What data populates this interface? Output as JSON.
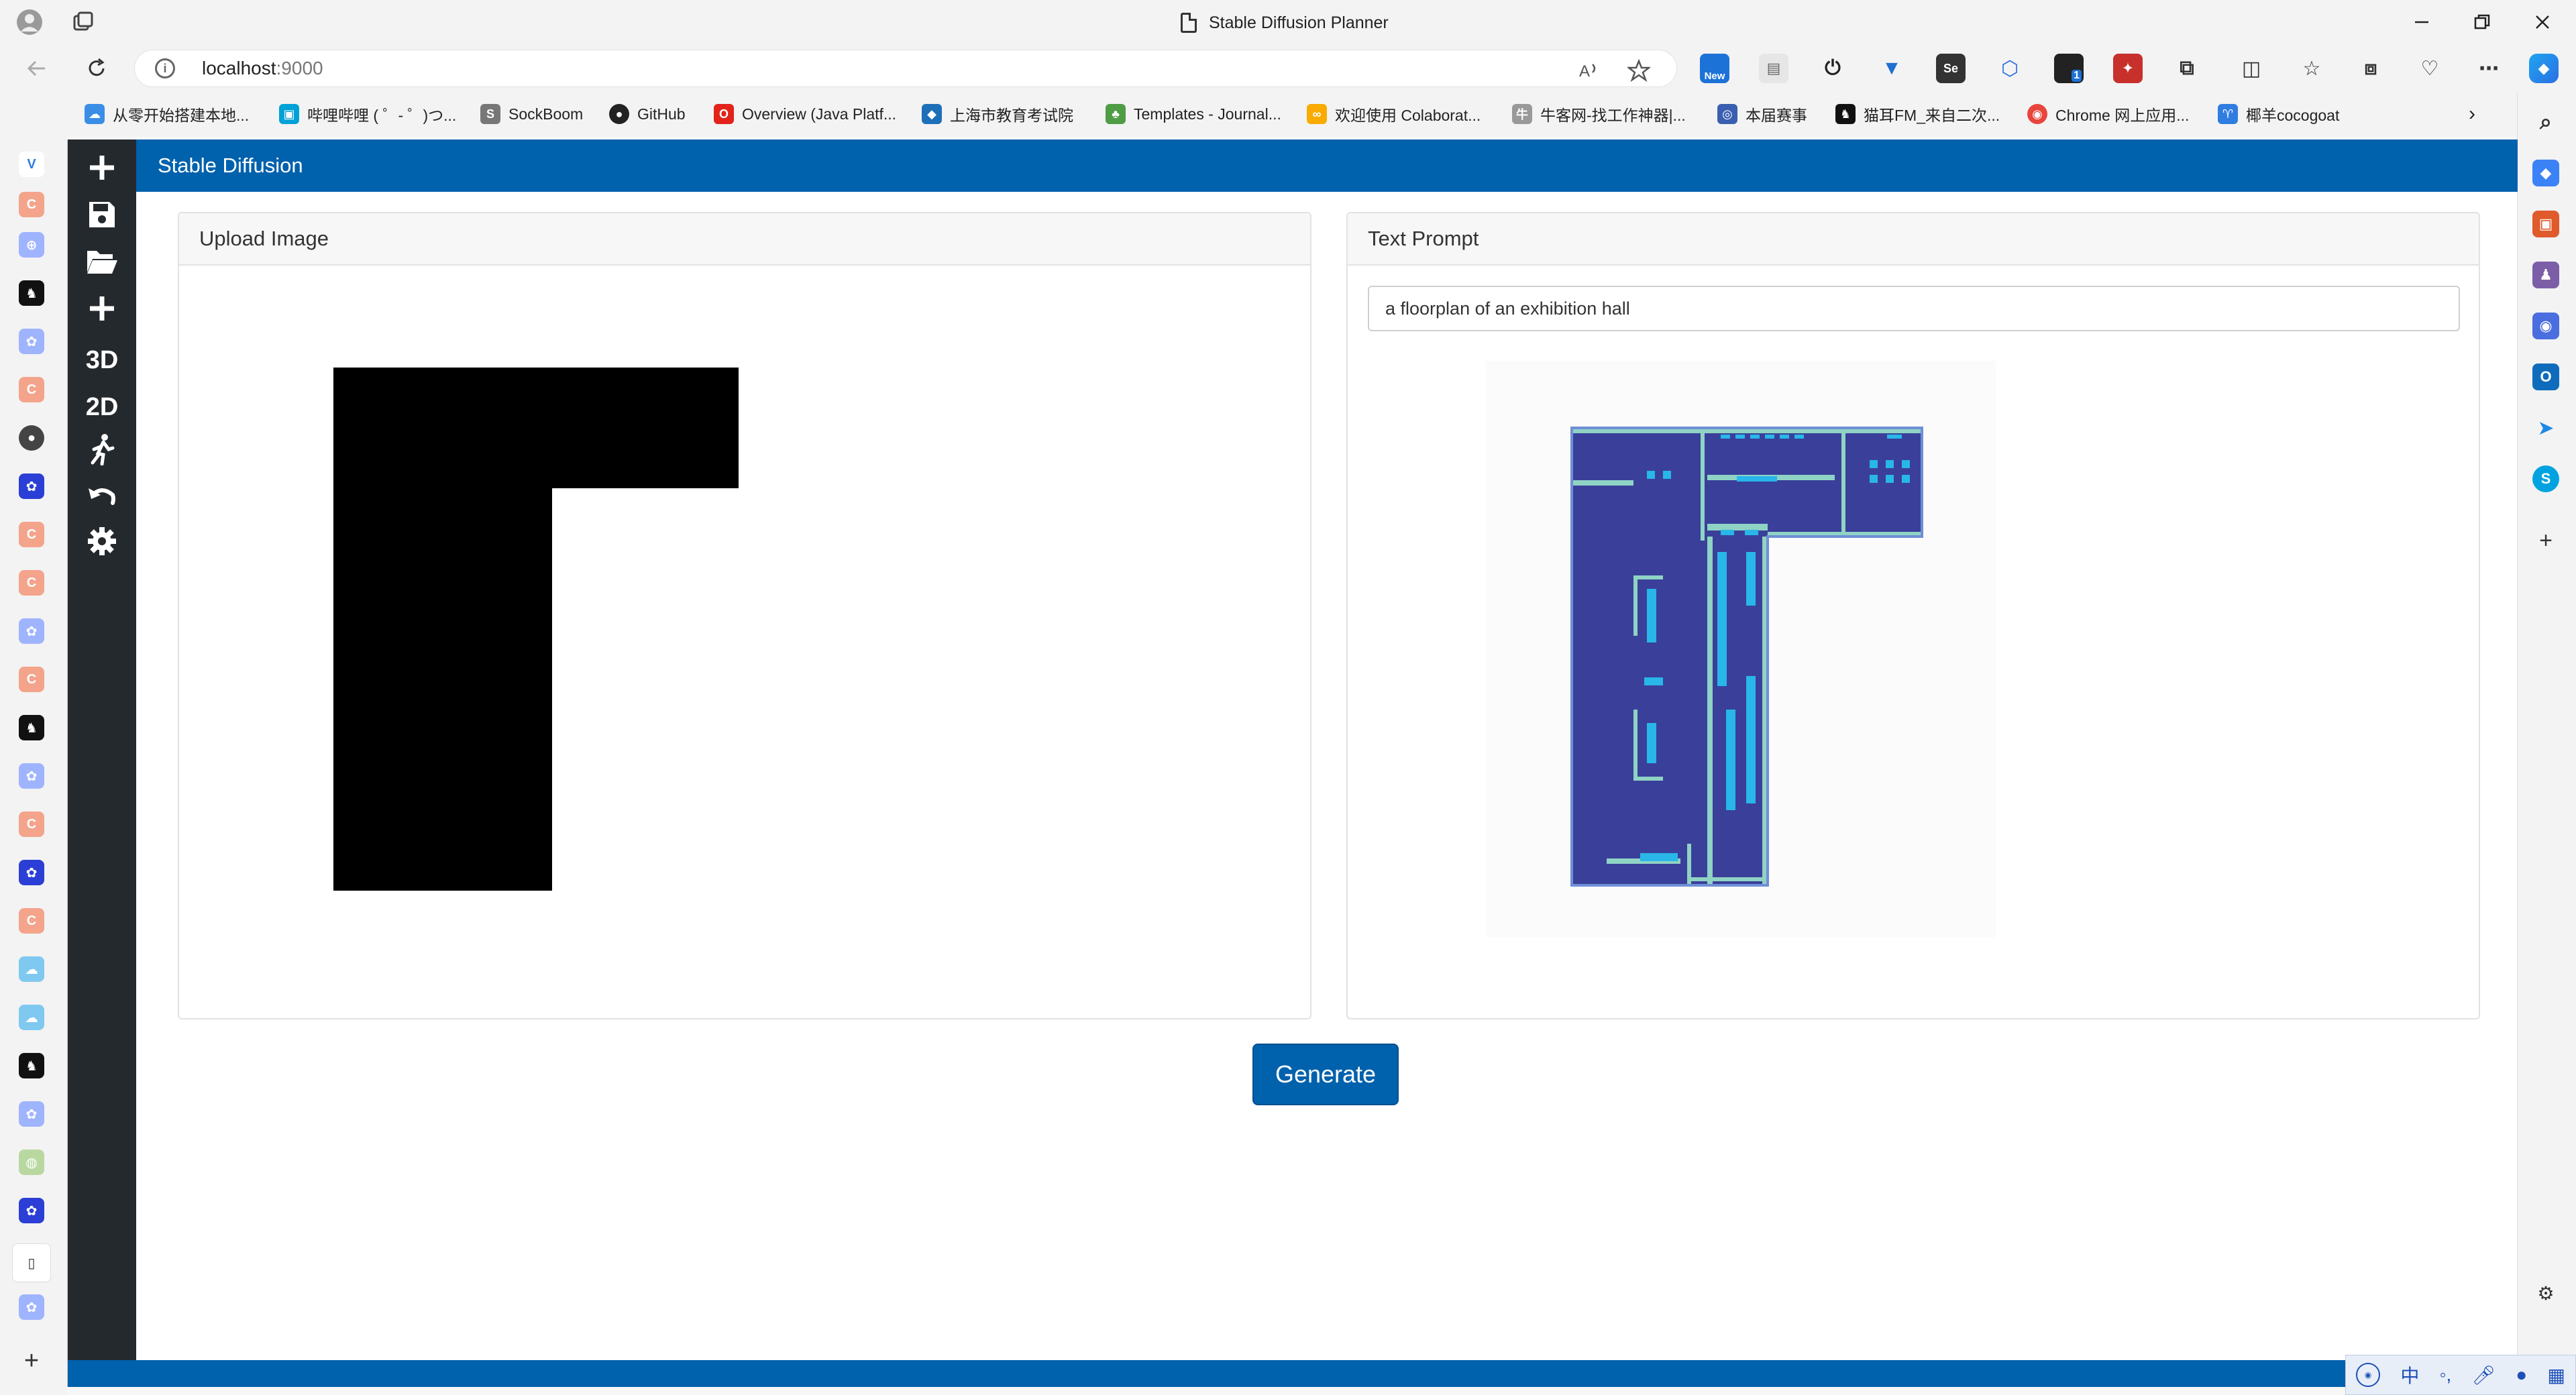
{
  "browser": {
    "window_title": "Stable Diffusion Planner",
    "url_host": "localhost",
    "url_port": ":9000",
    "extension_badge_new": "New",
    "extension_badge_count": "1",
    "extension_se": "Se"
  },
  "bookmarks": [
    {
      "label": "从零开始搭建本地...",
      "icon": "cloud-icon",
      "color": "#3a8ee6"
    },
    {
      "label": "哔哩哔哩 ( ゜- ゜)つ...",
      "icon": "bilibili-icon",
      "color": "#00a1d6"
    },
    {
      "label": "SockBoom",
      "icon": "sockboom-icon",
      "color": "#777777"
    },
    {
      "label": "GitHub",
      "icon": "github-icon",
      "color": "#222222"
    },
    {
      "label": "Overview (Java Platf...",
      "icon": "oracle-icon",
      "color": "#e2231a"
    },
    {
      "label": "上海市教育考试院",
      "icon": "school-icon",
      "color": "#1d6fb8"
    },
    {
      "label": "Templates - Journal...",
      "icon": "overleaf-icon",
      "color": "#4f9c45"
    },
    {
      "label": "欢迎使用 Colaborat...",
      "icon": "colab-icon",
      "color": "#f9ab00"
    },
    {
      "label": "牛客网-找工作神器|...",
      "icon": "nowcoder-icon",
      "color": "#999999"
    },
    {
      "label": "本届赛事",
      "icon": "contest-icon",
      "color": "#3a5fb0"
    },
    {
      "label": "猫耳FM_来自二次...",
      "icon": "missevan-icon",
      "color": "#111111"
    },
    {
      "label": "Chrome 网上应用...",
      "icon": "chrome-store-icon",
      "color": "#e8453c"
    },
    {
      "label": "椰羊cocogoat",
      "icon": "cocogoat-icon",
      "color": "#2f7de1"
    }
  ],
  "app": {
    "header_title": "Stable Diffusion",
    "toolbar": [
      {
        "name": "add-tool",
        "glyph": "+"
      },
      {
        "name": "save-tool",
        "glyph": "save"
      },
      {
        "name": "open-folder-tool",
        "glyph": "folder"
      },
      {
        "name": "add-object-tool",
        "glyph": "+"
      },
      {
        "name": "view-3d-tool",
        "glyph": "3D"
      },
      {
        "name": "view-2d-tool",
        "glyph": "2D"
      },
      {
        "name": "walk-tool",
        "glyph": "walk"
      },
      {
        "name": "undo-tool",
        "glyph": "undo"
      },
      {
        "name": "settings-tool",
        "glyph": "gear"
      }
    ],
    "upload_card": {
      "title": "Upload Image"
    },
    "prompt_card": {
      "title": "Text Prompt",
      "prompt_value": "a floorplan of an exhibition hall"
    },
    "generate_label": "Generate"
  },
  "colors": {
    "brand_blue": "#0061ad",
    "toolbar_dark": "#24292e",
    "floorplan_fill": "#3a3f9a",
    "floorplan_accent": "#29b6e8",
    "floorplan_wall": "#8fd3c4"
  },
  "ime": {
    "mode": "中"
  }
}
